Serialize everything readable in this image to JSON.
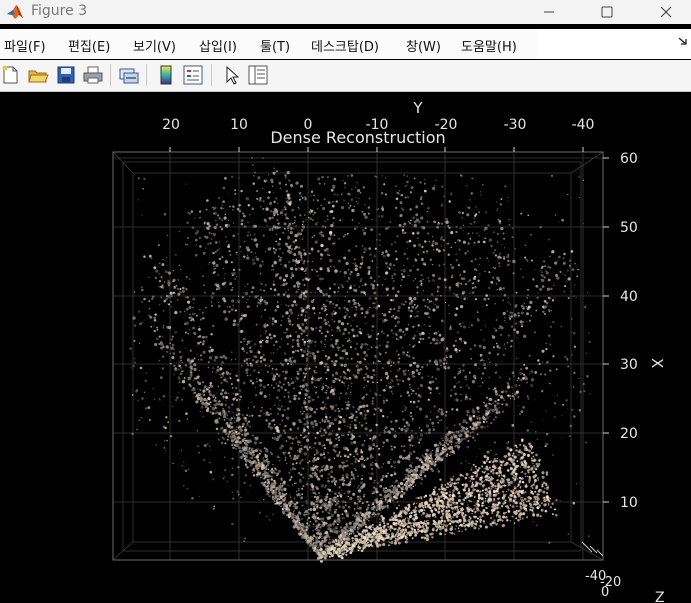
{
  "window": {
    "title": "Figure 3",
    "app_icon": "matlab-icon",
    "controls": [
      "minimize-icon",
      "maximize-icon",
      "close-icon"
    ]
  },
  "menu": {
    "items": [
      "파일(F)",
      "편집(E)",
      "보기(V)",
      "삽입(I)",
      "툴(T)",
      "데스크탑(D)",
      "창(W)",
      "도움말(H)"
    ],
    "overflow_icon": "dock-arrow-icon"
  },
  "toolbar": {
    "buttons": [
      "new-figure-icon",
      "open-file-icon",
      "save-icon",
      "print-icon",
      "link-plot-icon",
      "colorbar-icon",
      "legend-icon",
      "edit-plot-icon",
      "property-inspector-icon"
    ]
  },
  "plot": {
    "title": "Dense Reconstruction",
    "y_axis_label": "Y",
    "x_axis_label": "X",
    "z_axis_label": "Z",
    "y_ticks": [
      "20",
      "10",
      "0",
      "-10",
      "-20",
      "-30",
      "-40"
    ],
    "x_ticks": [
      "60",
      "50",
      "40",
      "30",
      "20",
      "10"
    ],
    "z_ticks": [
      "-40",
      "-20",
      "0"
    ],
    "colors": {
      "background": "#000000",
      "text": "#e6e6e6",
      "box": "#6b6b6b",
      "grid": "#3a3a3a"
    }
  }
}
